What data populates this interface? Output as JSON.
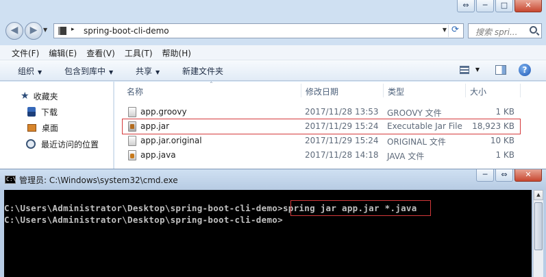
{
  "explorer": {
    "window_buttons": {
      "restore": "⇔",
      "minimize": "─",
      "maximize": "□",
      "close": "✕"
    },
    "address": {
      "path": "spring-boot-cli-demo",
      "separator": "▸"
    },
    "search": {
      "placeholder": "搜索 spri..."
    },
    "menu": [
      "文件(F)",
      "编辑(E)",
      "查看(V)",
      "工具(T)",
      "帮助(H)"
    ],
    "toolbar": {
      "organize": "组织",
      "include_in_library": "包含到库中",
      "share": "共享",
      "new_folder": "新建文件夹",
      "help": "?"
    },
    "nav_pane": {
      "favorites": "收藏夹",
      "downloads": "下载",
      "desktop": "桌面",
      "recent": "最近访问的位置"
    },
    "columns": {
      "name": "名称",
      "date": "修改日期",
      "type": "类型",
      "size": "大小"
    },
    "files": [
      {
        "name": "app.groovy",
        "date": "2017/11/28 13:53",
        "type": "GROOVY 文件",
        "size": "1 KB",
        "highlighted": false
      },
      {
        "name": "app.jar",
        "date": "2017/11/29 15:24",
        "type": "Executable Jar File",
        "size": "18,923 KB",
        "highlighted": true
      },
      {
        "name": "app.jar.original",
        "date": "2017/11/29 15:24",
        "type": "ORIGINAL 文件",
        "size": "10 KB",
        "highlighted": false
      },
      {
        "name": "app.java",
        "date": "2017/11/28 14:18",
        "type": "JAVA 文件",
        "size": "1 KB",
        "highlighted": false
      }
    ]
  },
  "cmd": {
    "icon_text": "C:\\",
    "title": "管理员: C:\\Windows\\system32\\cmd.exe",
    "line1_prompt": "C:\\Users\\Administrator\\Desktop\\spring-boot-cli-demo>",
    "line1_command": "spring jar app.jar *.java",
    "line2": "C:\\Users\\Administrator\\Desktop\\spring-boot-cli-demo>",
    "scroll_up": "▲"
  },
  "colors": {
    "highlight": "#d4383a",
    "console_bg": "#000000",
    "console_text": "#c0c0c0"
  }
}
